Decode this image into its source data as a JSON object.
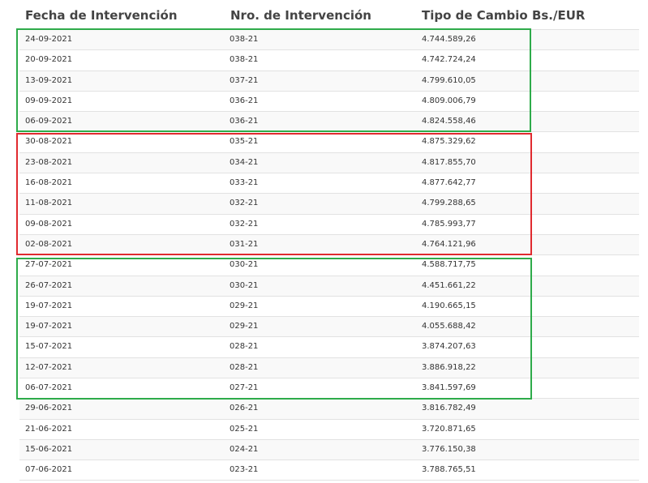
{
  "table": {
    "headers": [
      "Fecha de Intervención",
      "Nro. de Intervención",
      "Tipo de Cambio Bs./EUR"
    ],
    "rows": [
      [
        "24-09-2021",
        "038-21",
        "4.744.589,26"
      ],
      [
        "20-09-2021",
        "038-21",
        "4.742.724,24"
      ],
      [
        "13-09-2021",
        "037-21",
        "4.799.610,05"
      ],
      [
        "09-09-2021",
        "036-21",
        "4.809.006,79"
      ],
      [
        "06-09-2021",
        "036-21",
        "4.824.558,46"
      ],
      [
        "30-08-2021",
        "035-21",
        "4.875.329,62"
      ],
      [
        "23-08-2021",
        "034-21",
        "4.817.855,70"
      ],
      [
        "16-08-2021",
        "033-21",
        "4.877.642,77"
      ],
      [
        "11-08-2021",
        "032-21",
        "4.799.288,65"
      ],
      [
        "09-08-2021",
        "032-21",
        "4.785.993,77"
      ],
      [
        "02-08-2021",
        "031-21",
        "4.764.121,96"
      ],
      [
        "27-07-2021",
        "030-21",
        "4.588.717,75"
      ],
      [
        "26-07-2021",
        "030-21",
        "4.451.661,22"
      ],
      [
        "19-07-2021",
        "029-21",
        "4.190.665,15"
      ],
      [
        "19-07-2021",
        "029-21",
        "4.055.688,42"
      ],
      [
        "15-07-2021",
        "028-21",
        "3.874.207,63"
      ],
      [
        "12-07-2021",
        "028-21",
        "3.886.918,22"
      ],
      [
        "06-07-2021",
        "027-21",
        "3.841.597,69"
      ],
      [
        "29-06-2021",
        "026-21",
        "3.816.782,49"
      ],
      [
        "21-06-2021",
        "025-21",
        "3.720.871,65"
      ],
      [
        "15-06-2021",
        "024-21",
        "3.776.150,38"
      ],
      [
        "07-06-2021",
        "023-21",
        "3.788.765,51"
      ]
    ]
  },
  "highlights": {
    "green_color": "#2eab4a",
    "red_color": "#e02a2f",
    "boxes": [
      {
        "color": "green",
        "rows": "24-09-2021 to 06-09-2021"
      },
      {
        "color": "red",
        "rows": "30-08-2021 to 02-08-2021"
      },
      {
        "color": "green",
        "rows": "27-07-2021 to 06-07-2021"
      }
    ]
  }
}
